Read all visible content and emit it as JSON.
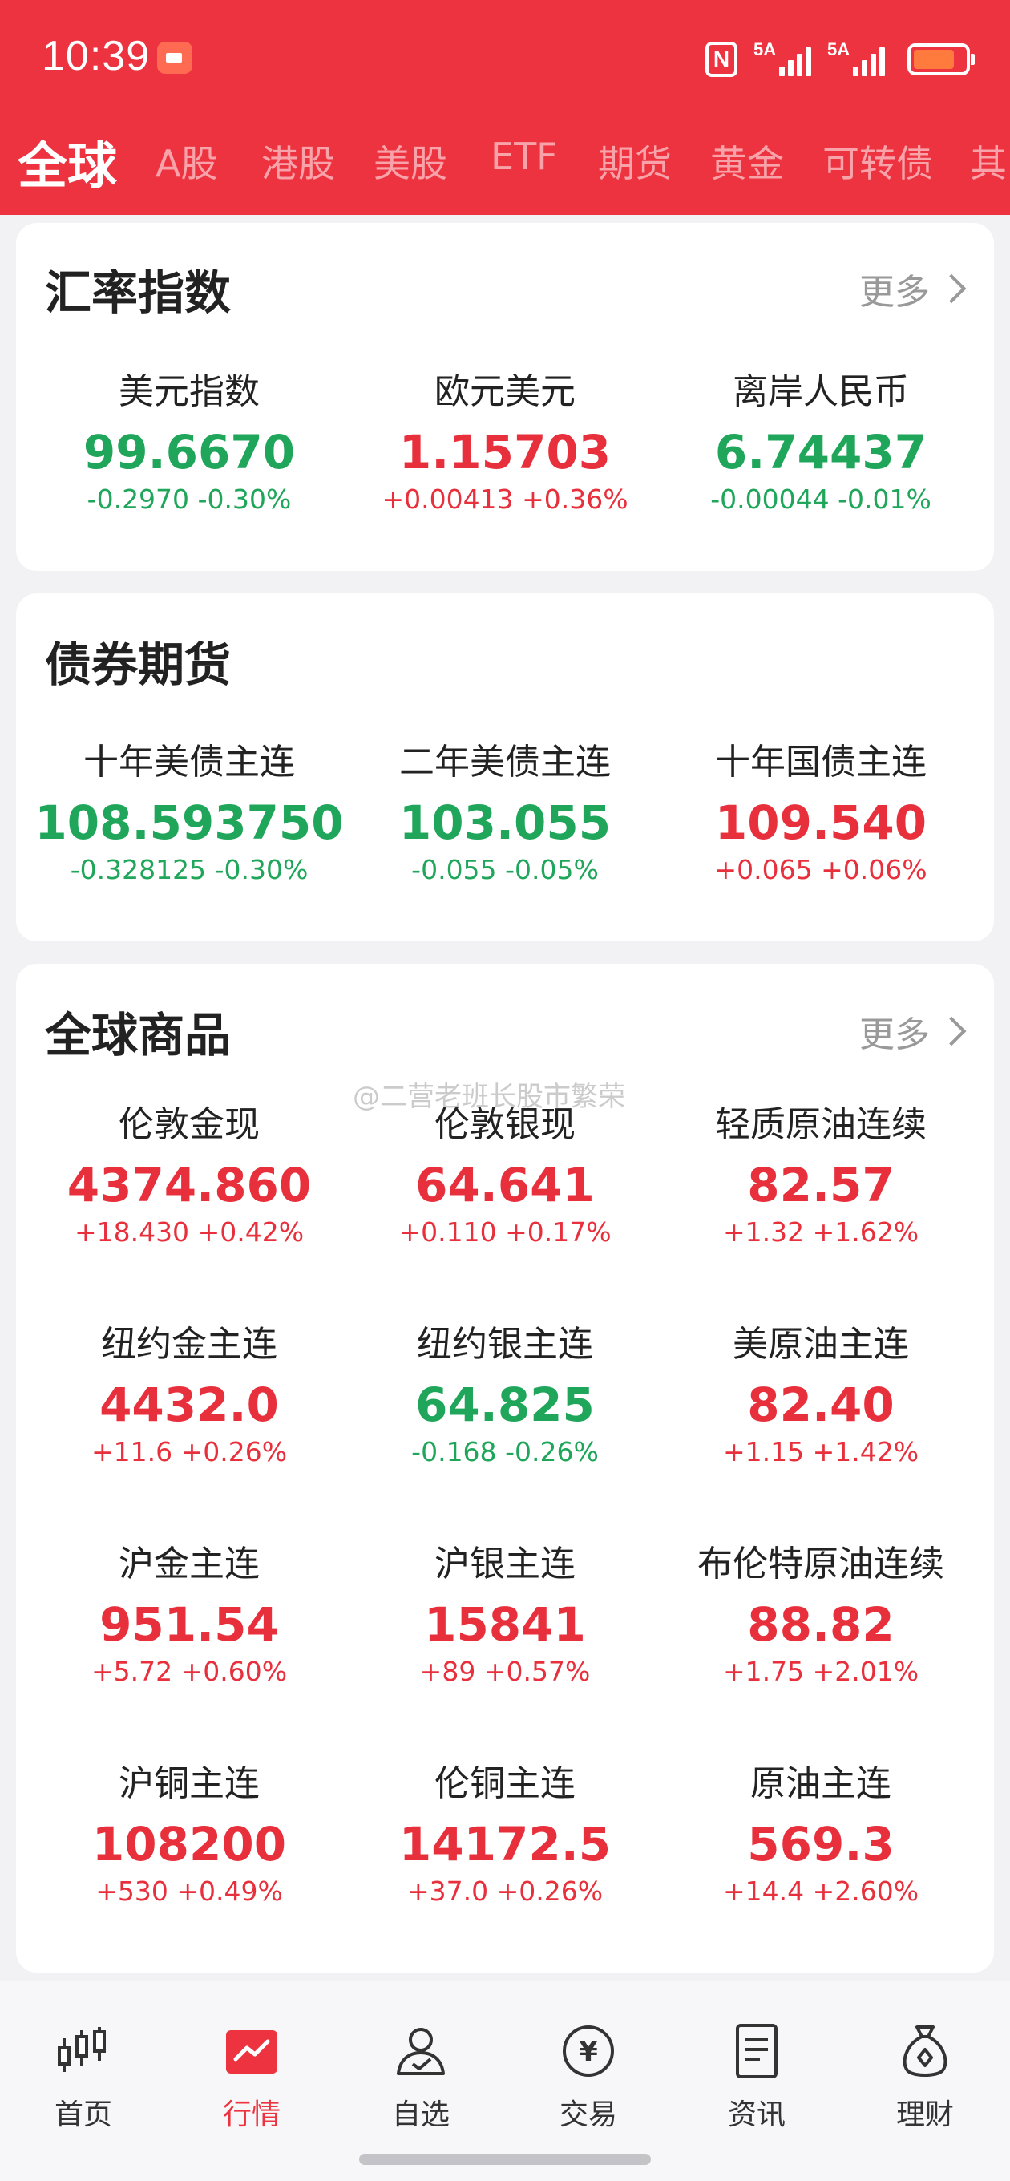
{
  "status": {
    "time": "10:39",
    "signal1": "5A",
    "signal2": "5A"
  },
  "tabs": [
    "全球",
    "A股",
    "港股",
    "美股",
    "ETF",
    "期货",
    "黄金",
    "可转债",
    "其"
  ],
  "more_label": "更多",
  "sections": {
    "fx": {
      "title": "汇率指数",
      "items": [
        {
          "name": "美元指数",
          "value": "99.6670",
          "change": "-0.2970",
          "pct": "-0.30%",
          "dir": "down"
        },
        {
          "name": "欧元美元",
          "value": "1.15703",
          "change": "+0.00413",
          "pct": "+0.36%",
          "dir": "up"
        },
        {
          "name": "离岸人民币",
          "value": "6.74437",
          "change": "-0.00044",
          "pct": "-0.01%",
          "dir": "down"
        }
      ]
    },
    "bonds": {
      "title": "债券期货",
      "items": [
        {
          "name": "十年美债主连",
          "value": "108.593750",
          "change": "-0.328125",
          "pct": "-0.30%",
          "dir": "down"
        },
        {
          "name": "二年美债主连",
          "value": "103.055",
          "change": "-0.055",
          "pct": "-0.05%",
          "dir": "down"
        },
        {
          "name": "十年国债主连",
          "value": "109.540",
          "change": "+0.065",
          "pct": "+0.06%",
          "dir": "up"
        }
      ]
    },
    "commodities": {
      "title": "全球商品",
      "items": [
        {
          "name": "伦敦金现",
          "value": "4374.860",
          "change": "+18.430",
          "pct": "+0.42%",
          "dir": "up"
        },
        {
          "name": "伦敦银现",
          "value": "64.641",
          "change": "+0.110",
          "pct": "+0.17%",
          "dir": "up"
        },
        {
          "name": "轻质原油连续",
          "value": "82.57",
          "change": "+1.32",
          "pct": "+1.62%",
          "dir": "up"
        },
        {
          "name": "纽约金主连",
          "value": "4432.0",
          "change": "+11.6",
          "pct": "+0.26%",
          "dir": "up"
        },
        {
          "name": "纽约银主连",
          "value": "64.825",
          "change": "-0.168",
          "pct": "-0.26%",
          "dir": "down"
        },
        {
          "name": "美原油主连",
          "value": "82.40",
          "change": "+1.15",
          "pct": "+1.42%",
          "dir": "up"
        },
        {
          "name": "沪金主连",
          "value": "951.54",
          "change": "+5.72",
          "pct": "+0.60%",
          "dir": "up"
        },
        {
          "name": "沪银主连",
          "value": "15841",
          "change": "+89",
          "pct": "+0.57%",
          "dir": "up"
        },
        {
          "name": "布伦特原油连续",
          "value": "88.82",
          "change": "+1.75",
          "pct": "+2.01%",
          "dir": "up"
        },
        {
          "name": "沪铜主连",
          "value": "108200",
          "change": "+530",
          "pct": "+0.49%",
          "dir": "up"
        },
        {
          "name": "伦铜主连",
          "value": "14172.5",
          "change": "+37.0",
          "pct": "+0.26%",
          "dir": "up"
        },
        {
          "name": "原油主连",
          "value": "569.3",
          "change": "+14.4",
          "pct": "+2.60%",
          "dir": "up"
        }
      ]
    }
  },
  "watermark": "@二营老班长股市繁荣",
  "bottom_nav": [
    {
      "label": "首页",
      "icon": "candlestick-icon"
    },
    {
      "label": "行情",
      "icon": "market-chart-icon",
      "active": true
    },
    {
      "label": "自选",
      "icon": "user-check-icon"
    },
    {
      "label": "交易",
      "icon": "yuan-coin-icon"
    },
    {
      "label": "资讯",
      "icon": "document-icon"
    },
    {
      "label": "理财",
      "icon": "money-bag-icon"
    }
  ],
  "colors": {
    "brand": "#ee3340",
    "up": "#e8303d",
    "down": "#1fa65a"
  }
}
